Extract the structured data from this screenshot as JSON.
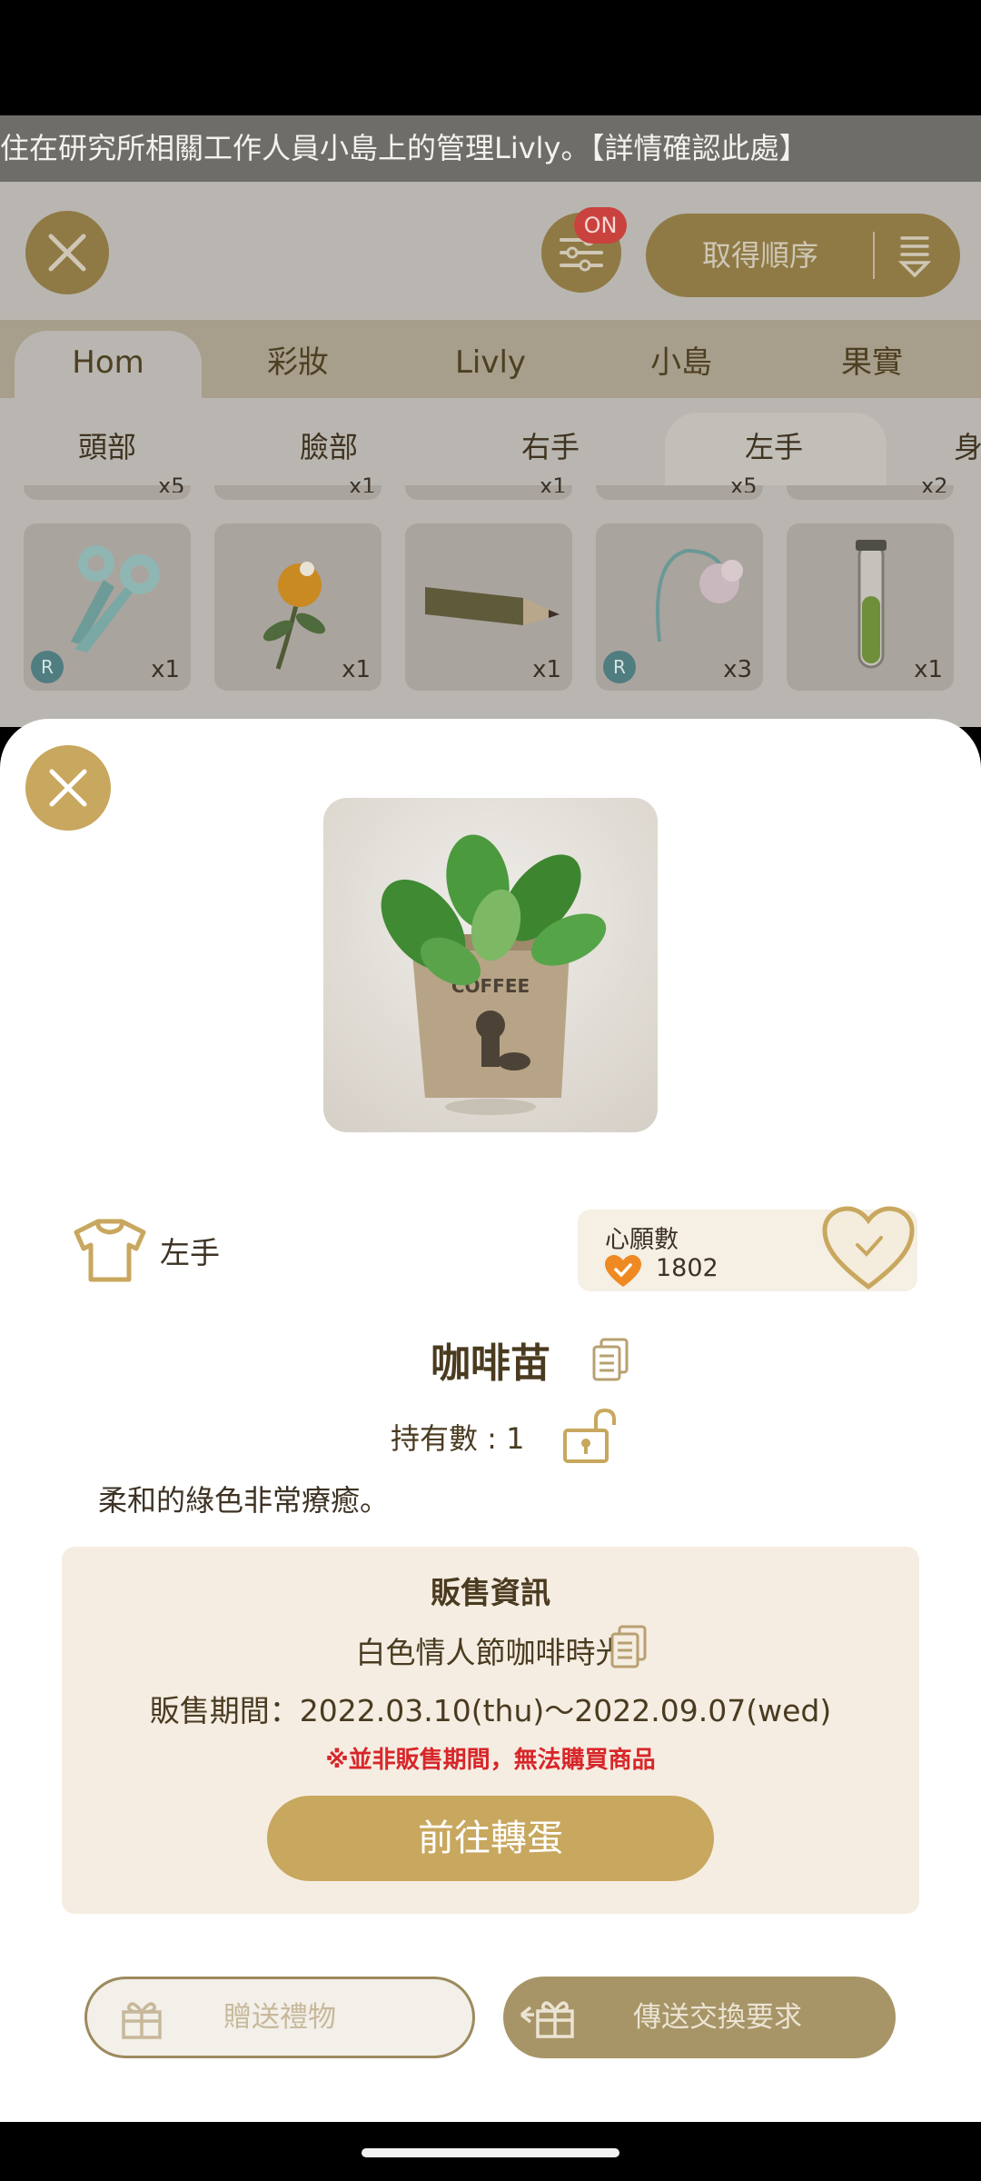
{
  "banner": {
    "text": "住在研究所相關工作人員小島上的管理Livly。【詳情確認此處】"
  },
  "toolbar": {
    "on_badge": "ON",
    "order_label": "取得順序"
  },
  "tabs": [
    {
      "label": "Hom"
    },
    {
      "label": "彩妝"
    },
    {
      "label": "Livly"
    },
    {
      "label": "小島"
    },
    {
      "label": "果實"
    }
  ],
  "subtabs": [
    {
      "label": "頭部"
    },
    {
      "label": "臉部"
    },
    {
      "label": "右手"
    },
    {
      "label": "左手"
    },
    {
      "label": "身"
    }
  ],
  "top_row_counts": [
    "x5",
    "x1",
    "x1",
    "x5",
    "x2"
  ],
  "items": [
    {
      "icon": "scissors-icon",
      "count": "x1",
      "badge": "R"
    },
    {
      "icon": "orange-flower-icon",
      "count": "x1",
      "badge": ""
    },
    {
      "icon": "pencil-icon",
      "count": "x1",
      "badge": ""
    },
    {
      "icon": "bell-flower-icon",
      "count": "x3",
      "badge": "R"
    },
    {
      "icon": "test-tube-icon",
      "count": "x1",
      "badge": ""
    }
  ],
  "detail": {
    "slot": "左手",
    "wish_title": "心願數",
    "wish_count": "1802",
    "name": "咖啡苗",
    "owned": "持有數 : 1",
    "description": "柔和的綠色非常療癒。",
    "image_text": "COFFEE"
  },
  "sale": {
    "title": "販售資訊",
    "event": "白色情人節咖啡時光",
    "period": "販售期間：2022.03.10(thu)～2022.09.07(wed)",
    "warning": "※並非販售期間，無法購買商品",
    "gacha_button": "前往轉蛋"
  },
  "actions": {
    "gift": "贈送禮物",
    "trade": "傳送交換要求"
  },
  "colors": {
    "accent": "#c8a75e",
    "warning": "#d8262a",
    "sheet": "#ffffff"
  }
}
